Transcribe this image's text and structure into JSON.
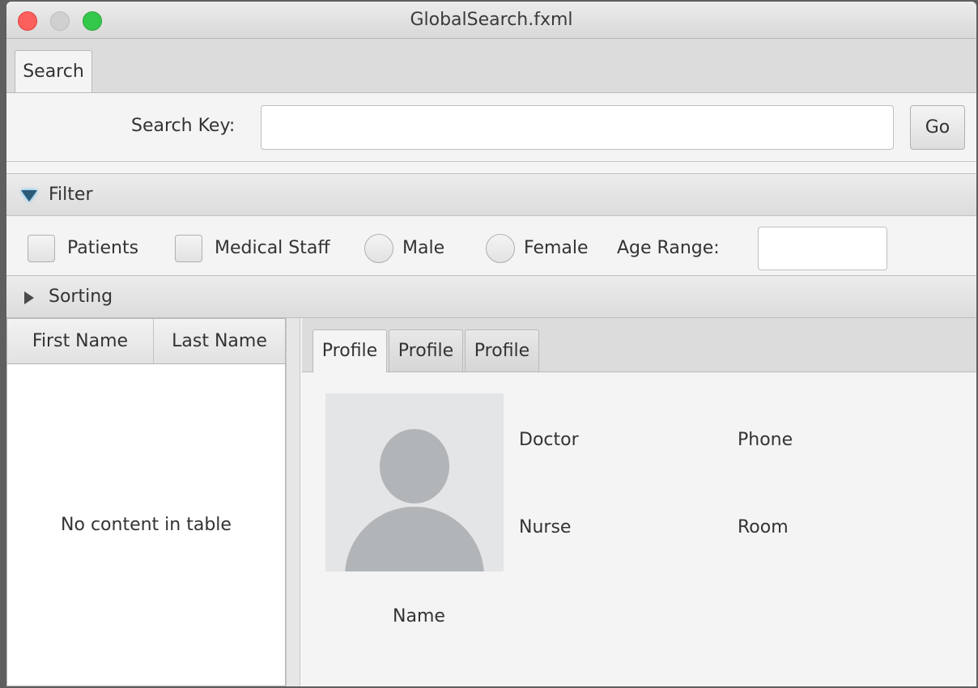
{
  "window": {
    "title": "GlobalSearch.fxml"
  },
  "tabs": {
    "top": [
      "Search"
    ]
  },
  "search": {
    "label": "Search Key:",
    "value": "",
    "placeholder": "",
    "go_label": "Go"
  },
  "filter": {
    "header": "Filter",
    "expanded": true,
    "patients_label": "Patients",
    "patients_checked": false,
    "staff_label": "Medical Staff",
    "staff_checked": false,
    "male_label": "Male",
    "male_selected": false,
    "female_label": "Female",
    "female_selected": false,
    "age_label": "Age Range:",
    "age_value": ""
  },
  "sorting": {
    "header": "Sorting",
    "expanded": false
  },
  "table": {
    "columns": [
      "First Name",
      "Last Name"
    ],
    "rows": [],
    "empty_message": "No content in table"
  },
  "profile": {
    "tabs": [
      "Profile",
      "Profile",
      "Profile"
    ],
    "active_tab": 0,
    "doctor_label": "Doctor",
    "phone_label": "Phone",
    "nurse_label": "Nurse",
    "room_label": "Room",
    "name_label": "Name"
  },
  "icons": {
    "filter_toggle": "triangle-down-icon",
    "sorting_toggle": "triangle-right-icon",
    "avatar": "user-silhouette-icon"
  },
  "colors": {
    "close": "#fc605c",
    "maximize": "#34c84a",
    "accent_glow": "#3ab0ff"
  }
}
